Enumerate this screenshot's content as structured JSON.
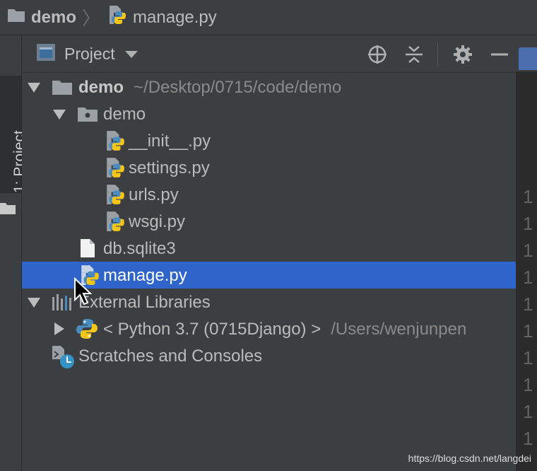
{
  "breadcrumb": {
    "root": "demo",
    "file": "manage.py"
  },
  "tool_strip": {
    "tab_label": "1: Project"
  },
  "panel": {
    "title": "Project"
  },
  "tree": {
    "root": {
      "name": "demo",
      "path": "~/Desktop/0715/code/demo"
    },
    "pkg": {
      "name": "demo"
    },
    "files": [
      "__init__.py",
      "settings.py",
      "urls.py",
      "wsgi.py"
    ],
    "db": "db.sqlite3",
    "manage": "manage.py",
    "external": "External Libraries",
    "python": {
      "name": "< Python 3.7 (0715Django) >",
      "path": "/Users/wenjunpen"
    },
    "scratches": "Scratches and Consoles"
  },
  "editor": {
    "line_numbers": [
      "1",
      "1",
      "1",
      "1",
      "1",
      "1",
      "1",
      "1",
      "1",
      "1"
    ]
  },
  "watermark": "https://blog.csdn.net/langdei",
  "colors": {
    "background": "#3c3f41",
    "selection": "#2f65ca",
    "python_blue": "#4b8bbe",
    "python_yellow": "#f5c518"
  }
}
